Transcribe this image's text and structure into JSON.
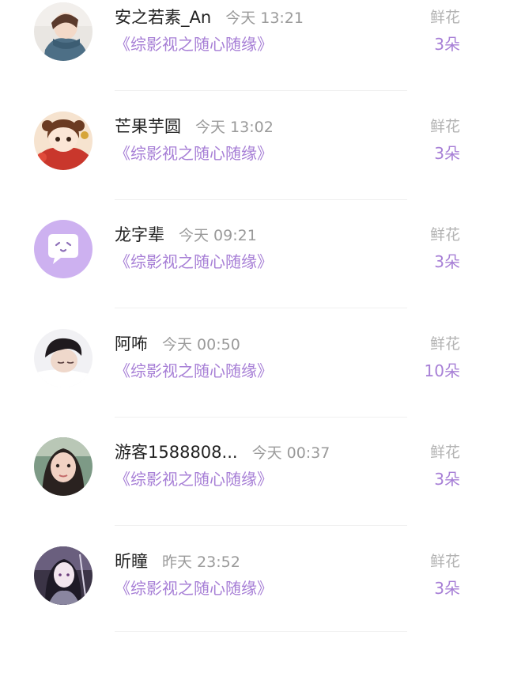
{
  "rows": [
    {
      "name": "安之若素_An",
      "time": "今天 13:21",
      "book": "《综影视之随心随缘》",
      "label": "鲜花",
      "count": "3朵",
      "avatar": "girl-scarf-avatar"
    },
    {
      "name": "芒果芋圆",
      "time": "今天 13:02",
      "book": "《综影视之随心随缘》",
      "label": "鲜花",
      "count": "3朵",
      "avatar": "cartoon-girl-avatar"
    },
    {
      "name": "龙字辈",
      "time": "今天 09:21",
      "book": "《综影视之随心随缘》",
      "label": "鲜花",
      "count": "3朵",
      "avatar": "default-chat-avatar"
    },
    {
      "name": "阿咘",
      "time": "今天 00:50",
      "book": "《综影视之随心随缘》",
      "label": "鲜花",
      "count": "10朵",
      "avatar": "boy-sleeping-avatar"
    },
    {
      "name": "游客1588808...",
      "time": "今天 00:37",
      "book": "《综影视之随心随缘》",
      "label": "鲜花",
      "count": "3朵",
      "avatar": "woman-selfie-avatar"
    },
    {
      "name": "昕瞳",
      "time": "昨天 23:52",
      "book": "《综影视之随心随缘》",
      "label": "鲜花",
      "count": "3朵",
      "avatar": "anime-character-avatar"
    }
  ],
  "colors": {
    "accent": "#a77fd6",
    "name": "#222222",
    "muted": "#9a9a9a",
    "default_avatar_bg": "#cdb1f0"
  }
}
